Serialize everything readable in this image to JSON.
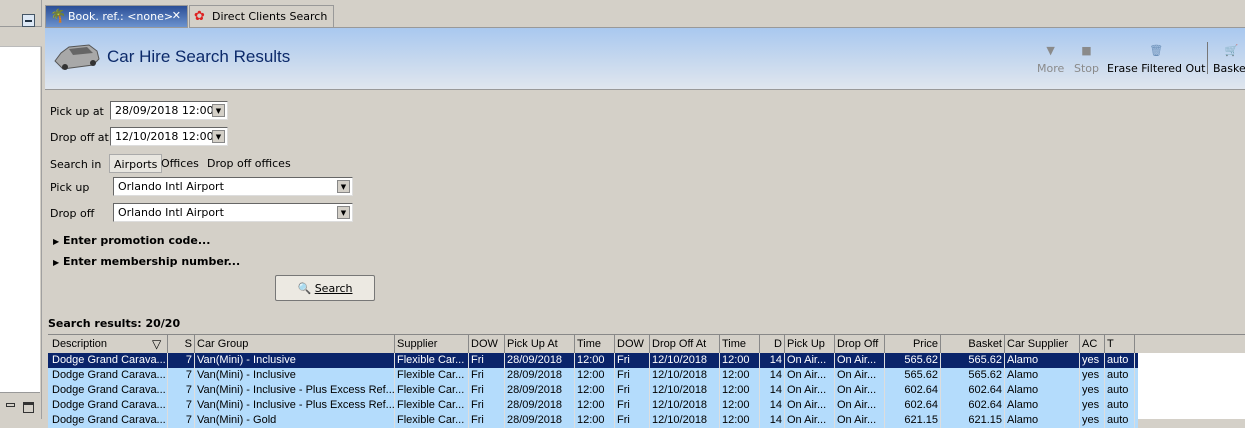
{
  "tabs": [
    {
      "label": "Book. ref.: <none>",
      "icon": "palm-tree-icon"
    },
    {
      "label": "Direct Clients Search",
      "icon": "clients-icon"
    }
  ],
  "header": {
    "title": "Car Hire Search Results"
  },
  "toolbar": {
    "more": "More",
    "stop": "Stop",
    "erase": "Erase Filtered Out",
    "basket": "Basket"
  },
  "form": {
    "pickup_at_label": "Pick up at",
    "pickup_at": "28/09/2018 12:00",
    "dropoff_at_label": "Drop off at",
    "dropoff_at": "12/10/2018 12:00",
    "search_in_label": "Search in",
    "search_in_options": [
      "Airports",
      "Offices",
      "Drop off offices"
    ],
    "pickup_label": "Pick up",
    "pickup": "Orlando Intl Airport",
    "dropoff_label": "Drop off",
    "dropoff": "Orlando Intl Airport",
    "promo": "Enter promotion code...",
    "membership": "Enter membership number...",
    "search_button": "Search"
  },
  "results": {
    "label": "Search results: 20/20",
    "columns": [
      "Description",
      "S",
      "Car Group",
      "Supplier",
      "DOW",
      "Pick Up At",
      "Time",
      "DOW",
      "Drop Off At",
      "Time",
      "D",
      "Pick Up",
      "Drop Off",
      "Price",
      "Basket",
      "Car Supplier",
      "AC",
      "T"
    ],
    "rows": [
      [
        "Dodge Grand Carava...",
        "7",
        "Van(Mini) - Inclusive",
        "Flexible Car...",
        "Fri",
        "28/09/2018",
        "12:00",
        "Fri",
        "12/10/2018",
        "12:00",
        "14",
        "On Air...",
        "On Air...",
        "565.62",
        "565.62",
        "Alamo",
        "yes",
        "auto"
      ],
      [
        "Dodge Grand Carava...",
        "7",
        "Van(Mini) - Inclusive",
        "Flexible Car...",
        "Fri",
        "28/09/2018",
        "12:00",
        "Fri",
        "12/10/2018",
        "12:00",
        "14",
        "On Air...",
        "On Air...",
        "565.62",
        "565.62",
        "Alamo",
        "yes",
        "auto"
      ],
      [
        "Dodge Grand Carava...",
        "7",
        "Van(Mini) - Inclusive - Plus Excess Ref...",
        "Flexible Car...",
        "Fri",
        "28/09/2018",
        "12:00",
        "Fri",
        "12/10/2018",
        "12:00",
        "14",
        "On Air...",
        "On Air...",
        "602.64",
        "602.64",
        "Alamo",
        "yes",
        "auto"
      ],
      [
        "Dodge Grand Carava...",
        "7",
        "Van(Mini) - Inclusive - Plus Excess Ref...",
        "Flexible Car...",
        "Fri",
        "28/09/2018",
        "12:00",
        "Fri",
        "12/10/2018",
        "12:00",
        "14",
        "On Air...",
        "On Air...",
        "602.64",
        "602.64",
        "Alamo",
        "yes",
        "auto"
      ],
      [
        "Dodge Grand Carava...",
        "7",
        "Van(Mini) - Gold",
        "Flexible Car...",
        "Fri",
        "28/09/2018",
        "12:00",
        "Fri",
        "12/10/2018",
        "12:00",
        "14",
        "On Air...",
        "On Air...",
        "621.15",
        "621.15",
        "Alamo",
        "yes",
        "auto"
      ]
    ]
  }
}
